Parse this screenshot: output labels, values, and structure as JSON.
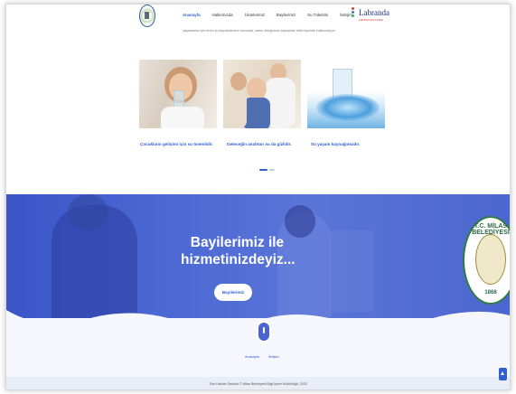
{
  "header": {
    "nav": [
      "Anasayfa",
      "Hakkımızda",
      "Ürünlerimiz",
      "Bayilerimiz",
      "Su Tüketimi",
      "İletişim"
    ],
    "active_index": 0,
    "partner_logo": {
      "word": "Labranda",
      "tag": "LABORATUVAR & ARGE"
    }
  },
  "intro": "yaşamamız için temiz su kaynaklarımızı korumak, sahip olduğumuz kaynakları etkin biçimde kullanmalıyız.",
  "cards": [
    {
      "caption": "Çocukların gelişimi için su önemlidir."
    },
    {
      "caption": "Geleceğin anahtarı su da gizlidir."
    },
    {
      "caption": "Su yaşam kaynağımızdır."
    }
  ],
  "banner": {
    "title": "Bayilerimiz ile hizmetinizdeyiz...",
    "button": "Bayilerimiz",
    "seal_text": "T.C. MİLAS BELEDİYESİ",
    "seal_year": "1868"
  },
  "footer": {
    "links": [
      "Anasayfa",
      "İletişim"
    ],
    "copyright": "Tüm Hakları Saklıdır © Milas Belediyesi Bilgi İşlem Müdürlüğü, 2023"
  },
  "colors": {
    "accent": "#2f5fd0",
    "banner": "#4a67d3"
  }
}
